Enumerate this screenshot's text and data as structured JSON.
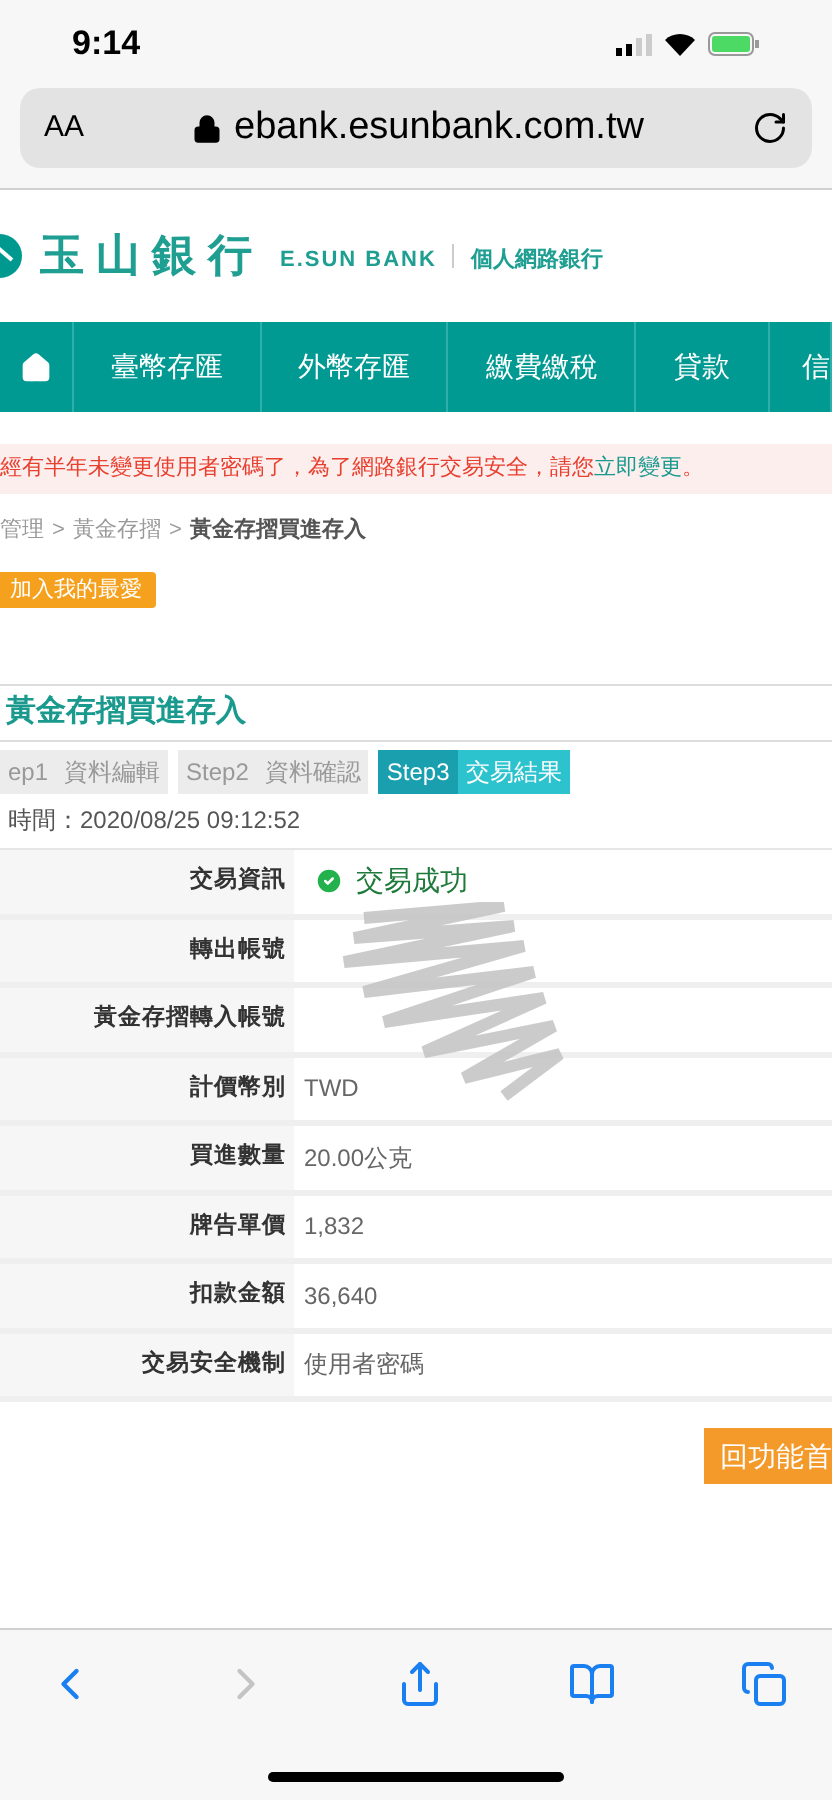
{
  "status_bar": {
    "time": "9:14"
  },
  "browser": {
    "text_size": "AA",
    "url": "ebank.esunbank.com.tw"
  },
  "header": {
    "bank_name": "玉山銀行",
    "bank_name_en": "E.SUN BANK",
    "service": "個人網路銀行"
  },
  "nav": [
    "臺幣存匯",
    "外幣存匯",
    "繳費繳稅",
    "貸款",
    "信"
  ],
  "notice": {
    "text": "經有半年未變更使用者密碼了，為了網路銀行交易安全，請您",
    "link": "立即變更",
    "end": "。"
  },
  "breadcrumb": [
    "管理",
    ">",
    "黃金存摺",
    ">",
    "黃金存摺買進存入"
  ],
  "favorite_button": "加入我的最愛",
  "section_title": "黃金存摺買進存入",
  "steps": [
    {
      "step": "ep1",
      "label": "資料編輯",
      "selected": false
    },
    {
      "step": "Step2",
      "label": "資料確認",
      "selected": false
    },
    {
      "step": "Step3",
      "label": "交易結果",
      "selected": true
    }
  ],
  "transaction_time": "時間：2020/08/25 09:12:52",
  "rows": [
    {
      "label": "交易資訊",
      "value": "交易成功",
      "kind": "status"
    },
    {
      "label": "轉出帳號",
      "kind": "redacted"
    },
    {
      "label": "黃金存摺轉入帳號",
      "kind": "redacted"
    },
    {
      "label": "計價幣別",
      "value": "TWD",
      "kind": "text"
    },
    {
      "label": "買進數量",
      "value": "20.00公克",
      "kind": "text"
    },
    {
      "label": "牌告單價",
      "value": "1,832",
      "kind": "text"
    },
    {
      "label": "扣款金額",
      "value": "36,640",
      "kind": "text"
    },
    {
      "label": "交易安全機制",
      "value": "使用者密碼",
      "kind": "text"
    }
  ],
  "home_button": "回功能首"
}
